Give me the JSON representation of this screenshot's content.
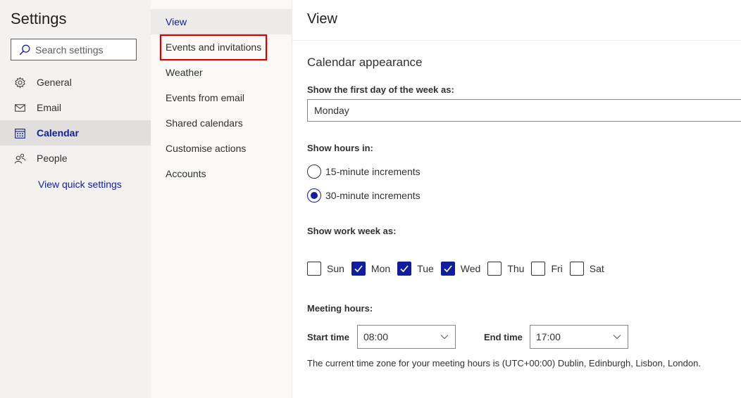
{
  "nav": {
    "title": "Settings",
    "search_placeholder": "Search settings",
    "items": [
      {
        "label": "General",
        "icon": "gear-icon"
      },
      {
        "label": "Email",
        "icon": "envelope-icon"
      },
      {
        "label": "Calendar",
        "icon": "calendar-icon"
      },
      {
        "label": "People",
        "icon": "people-icon"
      }
    ],
    "active_item": "Calendar",
    "quick_settings_link": "View quick settings"
  },
  "subnav": {
    "items": [
      "View",
      "Events and invitations",
      "Weather",
      "Events from email",
      "Shared calendars",
      "Customise actions",
      "Accounts"
    ],
    "active_item": "View",
    "highlighted_item": "Events and invitations"
  },
  "main": {
    "title": "View",
    "section_title": "Calendar appearance",
    "first_day_label": "Show the first day of the week as:",
    "first_day_value": "Monday",
    "hours_label": "Show hours in:",
    "hours_options": [
      {
        "label": "15-minute increments",
        "selected": false
      },
      {
        "label": "30-minute increments",
        "selected": true
      }
    ],
    "work_week_label": "Show work week as:",
    "days": [
      {
        "label": "Sun",
        "checked": false
      },
      {
        "label": "Mon",
        "checked": true
      },
      {
        "label": "Tue",
        "checked": true
      },
      {
        "label": "Wed",
        "checked": true
      },
      {
        "label": "Thu",
        "checked": false
      },
      {
        "label": "Fri",
        "checked": false
      },
      {
        "label": "Sat",
        "checked": false
      }
    ],
    "meeting_hours_label": "Meeting hours:",
    "start_time_label": "Start time",
    "start_time_value": "08:00",
    "end_time_label": "End time",
    "end_time_value": "17:00",
    "timezone_note": "The current time zone for your meeting hours is (UTC+00:00) Dublin, Edinburgh, Lisbon, London."
  },
  "colors": {
    "accent": "#0f1ea0",
    "highlight_box": "#d40000",
    "nav_bg": "#f3f2f1"
  }
}
